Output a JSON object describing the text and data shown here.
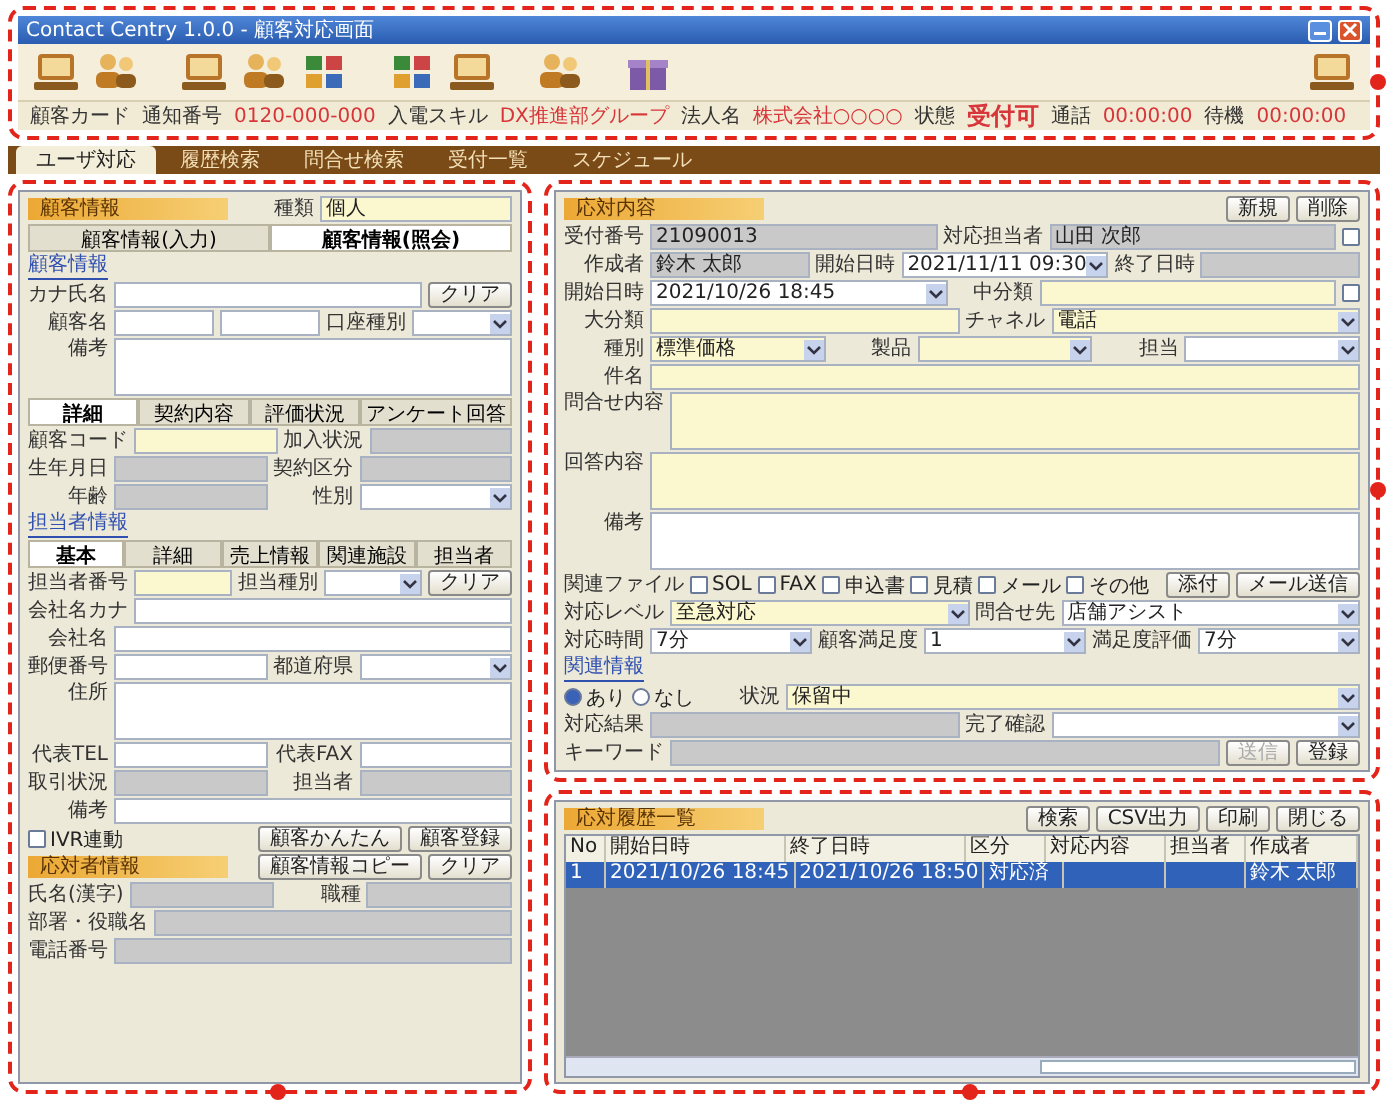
{
  "window": {
    "title": "Contact Centry 1.0.0 - 顧客対応画面"
  },
  "info_bar": [
    {
      "kind": "label",
      "text": "顧客カード"
    },
    {
      "kind": "label",
      "text": "通知番号"
    },
    {
      "kind": "value",
      "text": "0120-000-000"
    },
    {
      "kind": "label",
      "text": "入電スキル"
    },
    {
      "kind": "value",
      "text": "DX推進部グループ"
    },
    {
      "kind": "label",
      "text": "法人名"
    },
    {
      "kind": "value",
      "text": "株式会社○○○○"
    },
    {
      "kind": "label",
      "text": "状態"
    },
    {
      "kind": "status",
      "text": "受付可"
    },
    {
      "kind": "label",
      "text": "通話"
    },
    {
      "kind": "value",
      "text": "00:00:00"
    },
    {
      "kind": "label",
      "text": "待機"
    },
    {
      "kind": "value",
      "text": "00:00:00"
    }
  ],
  "main_tabs": [
    {
      "label": "ユーザ対応",
      "selected": true
    },
    {
      "label": "履歴検索",
      "selected": false
    },
    {
      "label": "問合せ検索",
      "selected": false
    },
    {
      "label": "受付一覧",
      "selected": false
    },
    {
      "label": "スケジュール",
      "selected": false
    }
  ],
  "left": {
    "blocks": [
      {
        "kind": "row",
        "items": [
          {
            "kind": "bar",
            "text": "顧客情報"
          },
          {
            "kind": "label",
            "text": "種類"
          },
          {
            "kind": "input",
            "value": "個人",
            "required": true,
            "readonly": false
          }
        ]
      },
      {
        "kind": "tabs",
        "tabs": [
          {
            "label": "顧客情報(入力)",
            "selected": false
          },
          {
            "label": "顧客情報(照会)",
            "selected": true
          }
        ]
      },
      {
        "kind": "caption",
        "text": "顧客情報"
      },
      {
        "kind": "row",
        "items": [
          {
            "kind": "label",
            "text": "カナ氏名"
          },
          {
            "kind": "input",
            "required": false,
            "readonly": false
          },
          {
            "kind": "button",
            "text": "クリア"
          }
        ]
      },
      {
        "kind": "row",
        "items": [
          {
            "kind": "label",
            "text": "顧客名"
          },
          {
            "kind": "input",
            "required": false,
            "readonly": false
          },
          {
            "kind": "input",
            "required": false,
            "readonly": false
          },
          {
            "kind": "label",
            "text": "口座種別"
          },
          {
            "kind": "select",
            "required": false,
            "readonly": false
          }
        ]
      },
      {
        "kind": "memo",
        "label": "備考",
        "required": false
      },
      {
        "kind": "tabs",
        "tabs": [
          {
            "label": "詳細",
            "selected": true
          },
          {
            "label": "契約内容",
            "selected": false
          },
          {
            "label": "評価状況",
            "selected": false
          },
          {
            "label": "アンケート回答",
            "selected": false
          }
        ]
      },
      {
        "kind": "row",
        "items": [
          {
            "kind": "label",
            "text": "顧客コード"
          },
          {
            "kind": "input",
            "required": true,
            "readonly": false
          },
          {
            "kind": "label",
            "text": "加入状況"
          },
          {
            "kind": "input",
            "required": false,
            "readonly": true
          }
        ]
      },
      {
        "kind": "row",
        "items": [
          {
            "kind": "label",
            "text": "生年月日"
          },
          {
            "kind": "input",
            "required": false,
            "readonly": true
          },
          {
            "kind": "label",
            "text": "契約区分"
          },
          {
            "kind": "input",
            "required": false,
            "readonly": true
          }
        ]
      },
      {
        "kind": "row",
        "items": [
          {
            "kind": "label",
            "text": "年齢"
          },
          {
            "kind": "input",
            "required": false,
            "readonly": true
          },
          {
            "kind": "label",
            "text": "性別"
          },
          {
            "kind": "select",
            "required": false,
            "readonly": false
          }
        ]
      },
      {
        "kind": "caption",
        "text": "担当者情報"
      },
      {
        "kind": "tabs",
        "tabs": [
          {
            "label": "基本",
            "selected": true
          },
          {
            "label": "詳細",
            "selected": false
          },
          {
            "label": "売上情報",
            "selected": false
          },
          {
            "label": "関連施設",
            "selected": false
          },
          {
            "label": "担当者",
            "selected": false
          }
        ]
      },
      {
        "kind": "row",
        "items": [
          {
            "kind": "label",
            "text": "担当者番号"
          },
          {
            "kind": "input",
            "required": true,
            "readonly": false
          },
          {
            "kind": "label",
            "text": "担当種別"
          },
          {
            "kind": "select",
            "required": false,
            "readonly": false
          },
          {
            "kind": "button",
            "text": "クリア"
          }
        ]
      },
      {
        "kind": "row",
        "items": [
          {
            "kind": "label",
            "text": "会社名カナ"
          },
          {
            "kind": "input",
            "required": false,
            "readonly": false
          }
        ]
      },
      {
        "kind": "row",
        "items": [
          {
            "kind": "label",
            "text": "会社名"
          },
          {
            "kind": "input",
            "required": false,
            "readonly": false
          }
        ]
      },
      {
        "kind": "row",
        "items": [
          {
            "kind": "label",
            "text": "郵便番号"
          },
          {
            "kind": "input",
            "required": false,
            "readonly": false
          },
          {
            "kind": "label",
            "text": "都道府県"
          },
          {
            "kind": "select",
            "required": false,
            "readonly": false
          }
        ]
      },
      {
        "kind": "memo",
        "label": "住所",
        "required": false
      },
      {
        "kind": "row",
        "items": [
          {
            "kind": "label",
            "text": "代表TEL"
          },
          {
            "kind": "input",
            "required": false,
            "readonly": false
          },
          {
            "kind": "label",
            "text": "代表FAX"
          },
          {
            "kind": "input",
            "required": false,
            "readonly": false
          }
        ]
      },
      {
        "kind": "row",
        "items": [
          {
            "kind": "label",
            "text": "取引状況"
          },
          {
            "kind": "input",
            "required": false,
            "readonly": true
          },
          {
            "kind": "label",
            "text": "担当者"
          },
          {
            "kind": "input",
            "required": false,
            "readonly": true
          }
        ]
      },
      {
        "kind": "row",
        "items": [
          {
            "kind": "label",
            "text": "備考"
          },
          {
            "kind": "input",
            "required": false,
            "readonly": false
          }
        ]
      },
      {
        "kind": "row",
        "items": [
          {
            "kind": "check",
            "text": "IVR連動",
            "checked": false
          },
          {
            "kind": "button",
            "text": "顧客かんたん"
          },
          {
            "kind": "button",
            "text": "顧客登録"
          }
        ]
      },
      {
        "kind": "row",
        "items": [
          {
            "kind": "bar",
            "text": "応対者情報"
          },
          {
            "kind": "button",
            "text": "顧客情報コピー"
          },
          {
            "kind": "button",
            "text": "クリア"
          }
        ]
      },
      {
        "kind": "row",
        "items": [
          {
            "kind": "label",
            "text": "氏名(漢字)"
          },
          {
            "kind": "input",
            "required": false,
            "readonly": true
          },
          {
            "kind": "label",
            "text": "職種"
          },
          {
            "kind": "input",
            "required": false,
            "readonly": true
          }
        ]
      },
      {
        "kind": "row",
        "items": [
          {
            "kind": "label",
            "text": "部署・役職名"
          },
          {
            "kind": "input",
            "required": false,
            "readonly": true
          }
        ]
      },
      {
        "kind": "row",
        "items": [
          {
            "kind": "label",
            "text": "電話番号"
          },
          {
            "kind": "input",
            "required": false,
            "readonly": true
          }
        ]
      }
    ]
  },
  "right": {
    "blocks": [
      {
        "kind": "row",
        "items": [
          {
            "kind": "bar",
            "text": "応対内容"
          },
          {
            "kind": "button",
            "text": "新規"
          },
          {
            "kind": "button",
            "text": "削除"
          }
        ]
      },
      {
        "kind": "row",
        "items": [
          {
            "kind": "label",
            "text": "受付番号"
          },
          {
            "kind": "input",
            "value": "21090013",
            "required": false,
            "readonly": true
          },
          {
            "kind": "label",
            "text": "対応担当者"
          },
          {
            "kind": "input",
            "value": "山田 次郎",
            "required": false,
            "readonly": true
          },
          {
            "kind": "check",
            "checked": false
          }
        ]
      },
      {
        "kind": "row",
        "items": [
          {
            "kind": "label",
            "text": "作成者"
          },
          {
            "kind": "input",
            "value": "鈴木 太郎",
            "required": false,
            "readonly": true
          },
          {
            "kind": "label",
            "text": "開始日時"
          },
          {
            "kind": "select",
            "value": "2021/11/11 09:30",
            "required": false,
            "readonly": false
          },
          {
            "kind": "label",
            "text": "終了日時"
          },
          {
            "kind": "input",
            "required": false,
            "readonly": true
          }
        ]
      },
      {
        "kind": "row",
        "items": [
          {
            "kind": "label",
            "text": "開始日時"
          },
          {
            "kind": "select",
            "value": "2021/10/26 18:45",
            "required": false,
            "readonly": false
          },
          {
            "kind": "label",
            "text": "中分類"
          },
          {
            "kind": "input",
            "required": true,
            "readonly": false
          },
          {
            "kind": "check",
            "checked": false
          }
        ]
      },
      {
        "kind": "row",
        "items": [
          {
            "kind": "label",
            "text": "大分類"
          },
          {
            "kind": "input",
            "required": true,
            "readonly": false
          },
          {
            "kind": "label",
            "text": "チャネル"
          },
          {
            "kind": "select",
            "value": "電話",
            "required": true,
            "readonly": false
          }
        ]
      },
      {
        "kind": "row",
        "items": [
          {
            "kind": "label",
            "text": "種別"
          },
          {
            "kind": "select",
            "value": "標準価格",
            "required": true,
            "readonly": false
          },
          {
            "kind": "label",
            "text": "製品"
          },
          {
            "kind": "select",
            "required": true,
            "readonly": false
          },
          {
            "kind": "label",
            "text": "担当"
          },
          {
            "kind": "select",
            "required": false,
            "readonly": false
          }
        ]
      },
      {
        "kind": "row",
        "items": [
          {
            "kind": "label",
            "text": "件名"
          },
          {
            "kind": "input",
            "required": true,
            "readonly": false
          }
        ]
      },
      {
        "kind": "memo",
        "label": "問合せ内容",
        "required": true
      },
      {
        "kind": "memo",
        "label": "回答内容",
        "required": true
      },
      {
        "kind": "memo",
        "label": "備考",
        "required": false
      },
      {
        "kind": "row",
        "items": [
          {
            "kind": "label",
            "text": "関連ファイル"
          },
          {
            "kind": "check",
            "text": "SOL",
            "checked": false
          },
          {
            "kind": "check",
            "text": "FAX",
            "checked": false
          },
          {
            "kind": "check",
            "text": "申込書",
            "checked": false
          },
          {
            "kind": "check",
            "text": "見積",
            "checked": false
          },
          {
            "kind": "check",
            "text": "メール",
            "checked": false
          },
          {
            "kind": "check",
            "text": "その他",
            "checked": false
          },
          {
            "kind": "button",
            "text": "添付"
          },
          {
            "kind": "button",
            "text": "メール送信"
          }
        ]
      },
      {
        "kind": "row",
        "items": [
          {
            "kind": "label",
            "text": "対応レベル"
          },
          {
            "kind": "select",
            "value": "至急対応",
            "required": true,
            "readonly": false
          },
          {
            "kind": "label",
            "text": "問合せ先"
          },
          {
            "kind": "select",
            "value": "店舗アシスト",
            "required": false,
            "readonly": false
          }
        ]
      },
      {
        "kind": "row",
        "items": [
          {
            "kind": "label",
            "text": "対応時間"
          },
          {
            "kind": "select",
            "value": "7分",
            "required": false,
            "readonly": false
          },
          {
            "kind": "label",
            "text": "顧客満足度"
          },
          {
            "kind": "select",
            "value": "1",
            "required": false,
            "readonly": false
          },
          {
            "kind": "label",
            "text": "満足度評価"
          },
          {
            "kind": "select",
            "value": "7分",
            "required": false,
            "readonly": false
          }
        ]
      },
      {
        "kind": "caption",
        "text": "関連情報"
      },
      {
        "kind": "row",
        "items": [
          {
            "kind": "radio",
            "text": "あり",
            "selected": true
          },
          {
            "kind": "radio",
            "text": "なし",
            "selected": false
          },
          {
            "kind": "label",
            "text": "状況"
          },
          {
            "kind": "select",
            "value": "保留中",
            "required": true,
            "readonly": false
          }
        ]
      },
      {
        "kind": "row",
        "items": [
          {
            "kind": "label",
            "text": "対応結果"
          },
          {
            "kind": "input",
            "required": false,
            "readonly": true
          },
          {
            "kind": "label",
            "text": "完了確認"
          },
          {
            "kind": "select",
            "required": false,
            "readonly": false
          }
        ]
      },
      {
        "kind": "row",
        "items": [
          {
            "kind": "label",
            "text": "キーワード"
          },
          {
            "kind": "input",
            "required": false,
            "readonly": true
          },
          {
            "kind": "button",
            "text": "送信",
            "disabled": true
          },
          {
            "kind": "button",
            "text": "登録",
            "disabled": false
          }
        ]
      }
    ]
  },
  "history": {
    "blocks": [
      {
        "kind": "row",
        "items": [
          {
            "kind": "bar",
            "text": "応対履歴一覧"
          },
          {
            "kind": "button",
            "text": "検索"
          },
          {
            "kind": "button",
            "text": "CSV出力"
          },
          {
            "kind": "button",
            "text": "印刷"
          },
          {
            "kind": "button",
            "text": "閉じる"
          }
        ]
      },
      {
        "kind": "grid",
        "columns": [
          "No",
          "開始日時",
          "終了日時",
          "区分",
          "対応内容",
          "担当者",
          "作成者"
        ],
        "rows": [
          {
            "cells": [
              "1",
              "2021/10/26 18:45",
              "2021/10/26 18:50",
              "対応済",
              "",
              "",
              "鈴木 太郎"
            ],
            "selected": true
          }
        ]
      }
    ]
  }
}
